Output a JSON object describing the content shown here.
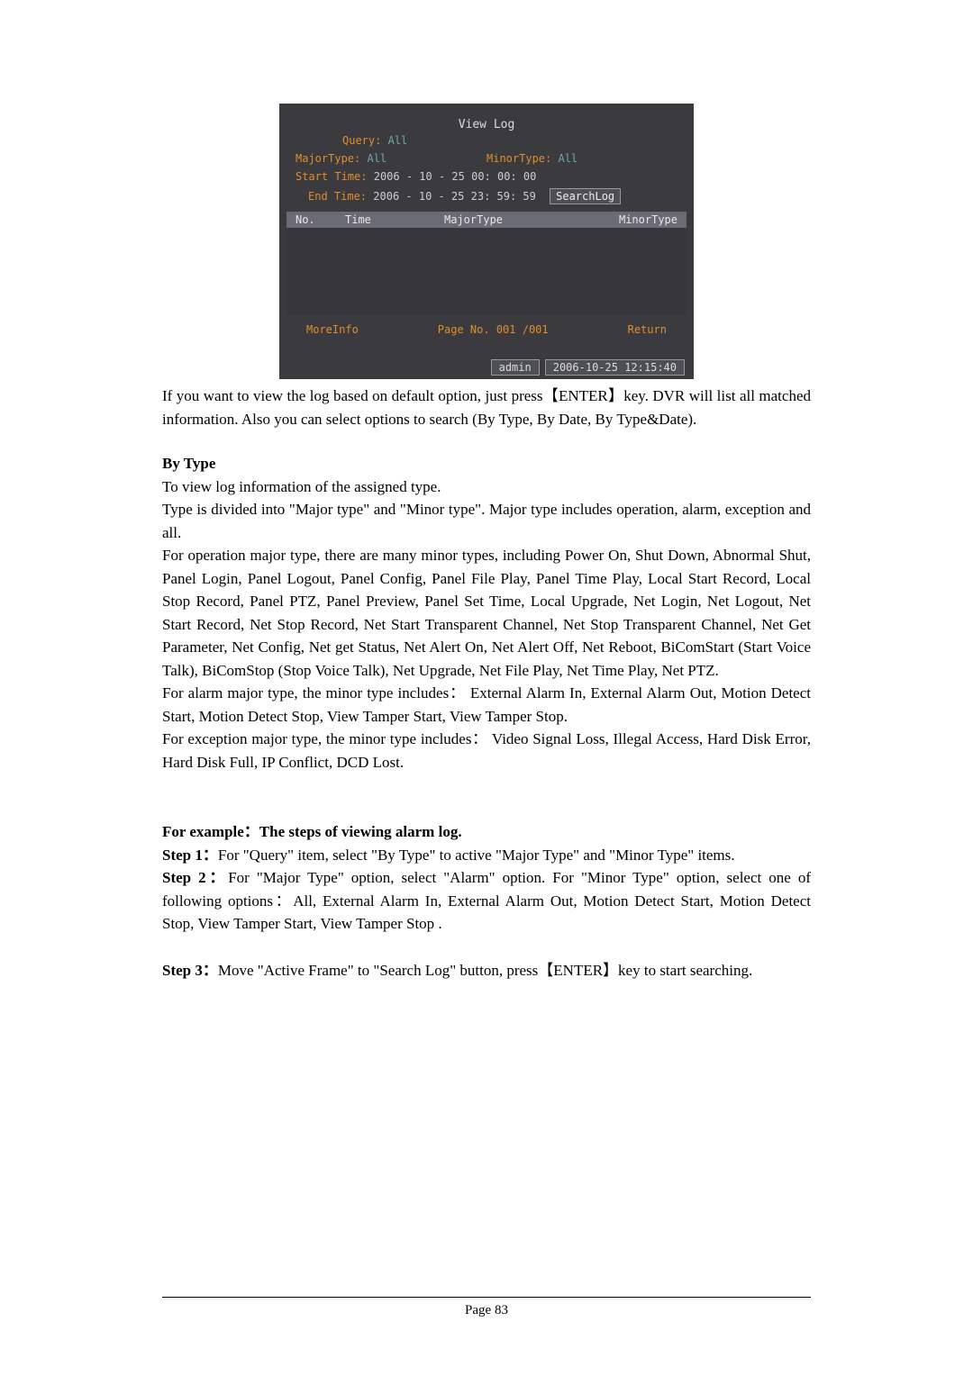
{
  "ui": {
    "title": "View Log",
    "query": {
      "label": "Query:",
      "value": "All"
    },
    "majorType": {
      "label": "MajorType:",
      "value": "All"
    },
    "minorType": {
      "label": "MinorType:",
      "value": "All"
    },
    "startTime": {
      "label": "Start Time:",
      "value": "2006 - 10 - 25   00: 00: 00"
    },
    "endTime": {
      "label": "End Time:",
      "value": "2006 - 10 - 25   23: 59: 59"
    },
    "searchLogBtn": "SearchLog",
    "headers": {
      "no": "No.",
      "time": "Time",
      "major": "MajorType",
      "minor": "MinorType"
    },
    "moreInfo": "MoreInfo",
    "pageNo": "Page No. 001 /001",
    "returnBtn": "Return",
    "statusUser": "admin",
    "statusTime": "2006-10-25 12:15:40"
  },
  "text": {
    "intro1": "If you want to view the log based on default option, just press【ENTER】key. DVR will list all matched information. Also you can select options to search (By Type, By Date, By Type&Date).",
    "byTypeHeading": "By Type",
    "byType1": "To view log information of the assigned type.",
    "byType2": "Type is divided into \"Major type\" and \"Minor type\". Major type includes operation, alarm, exception and all.",
    "byType3": "For operation major type, there are many minor types, including Power On, Shut Down, Abnormal Shut, Panel Login, Panel Logout, Panel Config, Panel File Play, Panel Time Play, Local Start Record, Local Stop Record, Panel PTZ, Panel Preview, Panel Set Time, Local Upgrade, Net Login, Net Logout, Net Start Record, Net Stop Record, Net Start Transparent Channel, Net Stop Transparent Channel, Net Get Parameter, Net Config, Net get Status, Net Alert On, Net Alert Off, Net Reboot, BiComStart (Start Voice Talk), BiComStop (Stop Voice Talk), Net Upgrade, Net File Play, Net Time Play, Net PTZ.",
    "byType4": "For alarm major type, the minor type includes： External Alarm In, External Alarm Out, Motion Detect Start, Motion Detect Stop, View Tamper Start, View Tamper Stop.",
    "byType5": "For exception major type, the minor type includes： Video Signal Loss, Illegal Access, Hard Disk Error, Hard Disk Full, IP Conflict, DCD Lost.",
    "exampleHeading": "For example：The steps of viewing alarm log.",
    "step1Label": "Step 1：",
    "step1": "For \"Query\" item, select \"By Type\" to active \"Major Type\" and \"Minor Type\" items.",
    "step2Label": "Step 2：",
    "step2": "For \"Major Type\" option, select \"Alarm\" option. For \"Minor Type\" option, select one of following options：All, External Alarm In, External Alarm Out, Motion Detect Start, Motion Detect Stop, View Tamper Start, View Tamper Stop .",
    "step3Label": "Step 3：",
    "step3": "Move \"Active Frame\" to \"Search Log\" button, press【ENTER】key to start searching.",
    "pageNumber": "Page 83"
  }
}
